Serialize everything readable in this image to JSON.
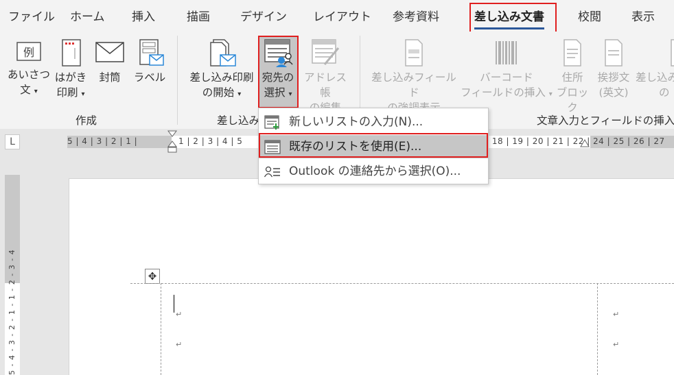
{
  "tabs": [
    "ファイル",
    "ホーム",
    "挿入",
    "描画",
    "デザイン",
    "レイアウト",
    "参考資料",
    "差し込み文書",
    "校閲",
    "表示"
  ],
  "ribbon": {
    "create_group": {
      "label": "作成",
      "buttons": [
        {
          "line1": "あいさつ",
          "line2": "文",
          "icon": "greeting-icon",
          "icon_text": "例"
        },
        {
          "line1": "はがき",
          "line2": "印刷",
          "icon": "postcard-icon"
        },
        {
          "line1": "封筒",
          "line2": "",
          "icon": "envelope-icon"
        },
        {
          "line1": "ラベル",
          "line2": "",
          "icon": "label-icon"
        }
      ]
    },
    "start_group": {
      "label": "差し込み",
      "buttons": [
        {
          "line1": "差し込み印刷",
          "line2": "の開始",
          "icon": "start-merge-icon"
        },
        {
          "line1": "宛先の",
          "line2": "選択",
          "icon": "select-recipients-icon"
        },
        {
          "line1": "アドレス帳",
          "line2": "の編集",
          "icon": "edit-address-book-icon",
          "disabled": true
        }
      ]
    },
    "fields_group": {
      "label": "文章入力とフィールドの挿入",
      "buttons": [
        {
          "line1": "差し込みフィールド",
          "line2": "の強調表示",
          "icon": "highlight-fields-icon"
        },
        {
          "line1": "バーコード",
          "line2": "フィールドの挿入",
          "icon": "barcode-icon"
        },
        {
          "line1": "住所",
          "line2": "ブロック",
          "icon": "address-block-icon"
        },
        {
          "line1": "挨拶文",
          "line2": "(英文)",
          "icon": "greeting-line-icon"
        },
        {
          "line1": "差し込み",
          "line2": "の",
          "icon": "insert-field-icon"
        }
      ]
    },
    "caret": "▾"
  },
  "dropdown": {
    "items": [
      {
        "label": "新しいリストの入力(N)...",
        "icon": "new-list-icon"
      },
      {
        "label": "既存のリストを使用(E)...",
        "icon": "existing-list-icon"
      },
      {
        "label": "Outlook の連絡先から選択(O)...",
        "icon": "outlook-contacts-icon"
      }
    ]
  },
  "ruler": {
    "corner": "L",
    "left_numbers": "5 | 4 | 3 | 2 | 1 |",
    "main_numbers": "1 | 2 | 3 | 4 | 5",
    "right_numbers": "| 18 | 19 | 20 | 21 | 22 | 23",
    "far_right_numbers": "24 | 25 | 26 | 27",
    "vertical_numbers": "5 - 4 - 3 - 2 - 1 -   1 - 2 - 3 - 4"
  },
  "document": {
    "move_handle": "✥",
    "para_mark": "↵"
  },
  "colors": {
    "highlight": "#e01e1e",
    "active_tab_underline": "#2b579a",
    "selection": "#c6c6c6"
  }
}
